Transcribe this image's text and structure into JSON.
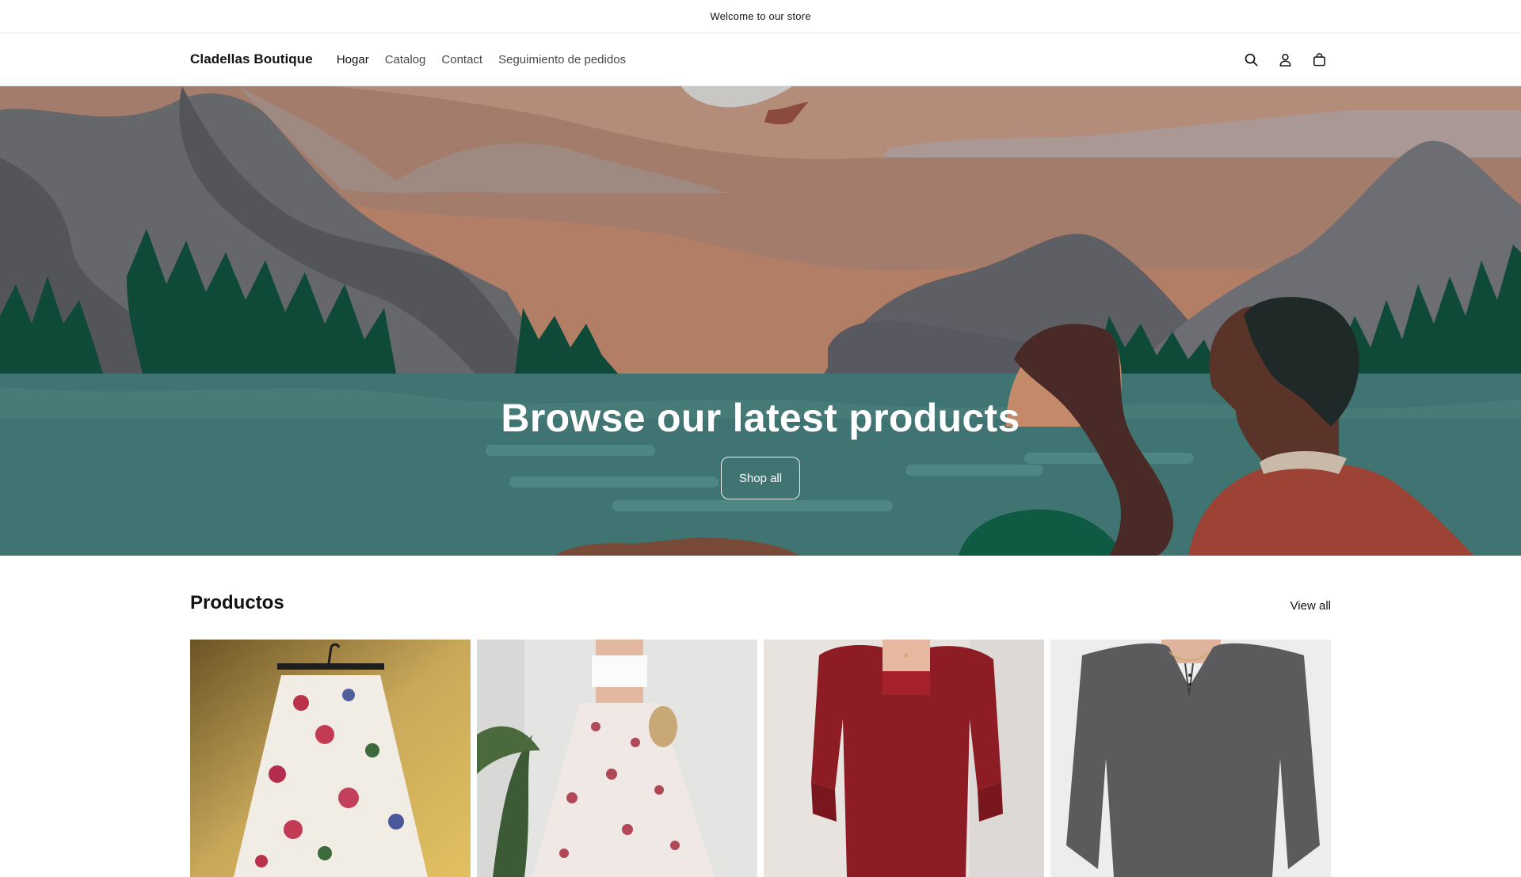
{
  "announcement": {
    "text": "Welcome to our store"
  },
  "header": {
    "logo": "Cladellas Boutique",
    "nav": [
      "Hogar",
      "Catalog",
      "Contact",
      "Seguimiento de pedidos"
    ],
    "icons": [
      "search-icon",
      "account-icon",
      "cart-icon"
    ]
  },
  "hero": {
    "title": "Browse our latest products",
    "button_label": "Shop all"
  },
  "products": {
    "title": "Productos",
    "view_all_label": "View all",
    "items": [
      {
        "image": "floral-skirt-on-hanger"
      },
      {
        "image": "floral-maxi-skirt-with-white-top"
      },
      {
        "image": "red-sparkle-long-sleeve-dress"
      },
      {
        "image": "grey-henley-long-sleeve-top"
      }
    ]
  },
  "colors": {
    "hero_water": "#3f7472",
    "hero_sky": "#a37c6b",
    "trees": "#0f4a38",
    "text_dark": "#121212"
  }
}
